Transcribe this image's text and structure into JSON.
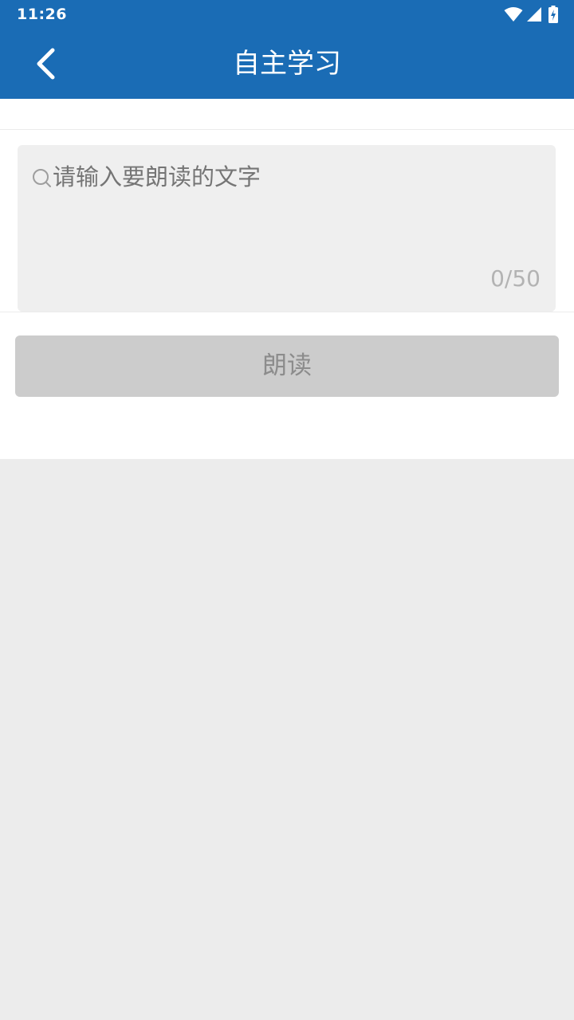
{
  "status_bar": {
    "time": "11:26",
    "icons": [
      "wifi-icon",
      "cellular-signal-icon",
      "battery-charging-icon"
    ]
  },
  "app_bar": {
    "title": "自主学习",
    "back_icon": "chevron-left-icon"
  },
  "input": {
    "placeholder": "请输入要朗读的文字",
    "value": "",
    "counter": "0/50"
  },
  "read_button": {
    "label": "朗读"
  },
  "colors": {
    "primary": "#1a6cb5",
    "background": "#ececec",
    "input_background": "#efefef",
    "button_disabled": "#cccccc",
    "button_text_disabled": "#8c8c8c"
  }
}
